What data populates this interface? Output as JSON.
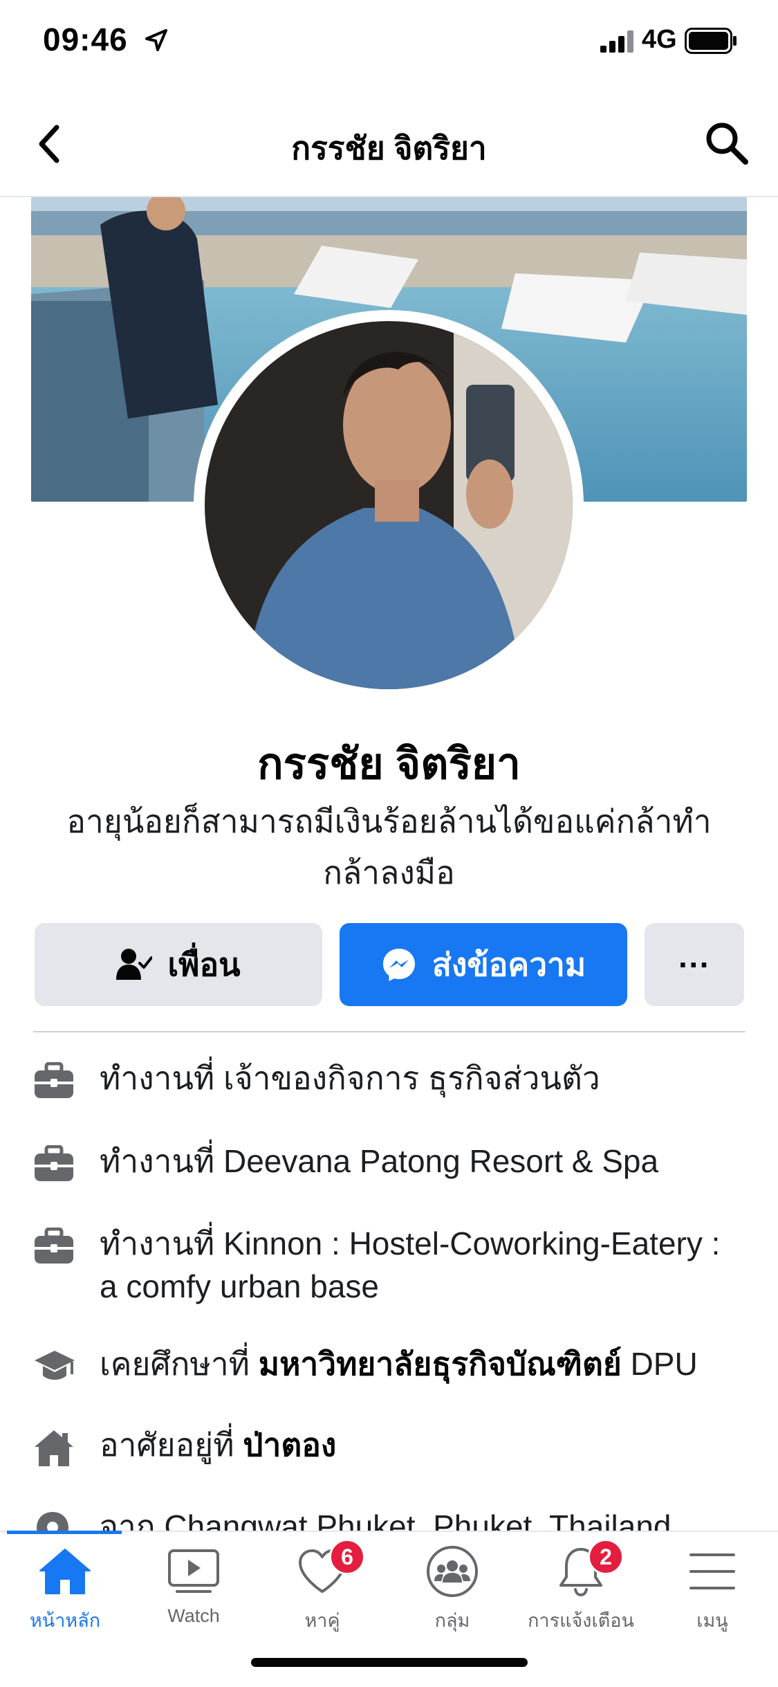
{
  "status_bar": {
    "time": "09:46",
    "network": "4G"
  },
  "header": {
    "title": "กรรชัย จิตริยา"
  },
  "profile": {
    "name": "กรรชัย จิตริยา",
    "bio_line1": "อายุน้อยก็สามารถมีเงินร้อยล้านได้ขอแค่กล้าทำ",
    "bio_line2": "กล้าลงมือ"
  },
  "actions": {
    "friends_label": "เพื่อน",
    "message_label": "ส่งข้อความ",
    "more_label": "···"
  },
  "details": [
    {
      "icon": "briefcase-icon",
      "prefix": "ทำงานที่",
      "text": "เจ้าของกิจการ ธุรกิจส่วนตัว"
    },
    {
      "icon": "briefcase-icon",
      "prefix": "ทำงานที่",
      "text": "Deevana Patong Resort & Spa"
    },
    {
      "icon": "briefcase-icon",
      "prefix": "ทำงานที่",
      "text": "Kinnon : Hostel-Coworking-Eatery :  a comfy urban base"
    },
    {
      "icon": "graduation-cap-icon",
      "prefix": "เคยศึกษาที่",
      "text": "มหาวิทยาลัยธุรกิจบัณฑิตย์",
      "suffix": "DPU"
    },
    {
      "icon": "house-icon",
      "prefix": "อาศัยอยู่ที่",
      "text": "ป่าตอง"
    },
    {
      "icon": "location-pin-icon",
      "prefix": "จาก",
      "text": "Changwat Phuket, Phuket, Thailand"
    }
  ],
  "tabs": [
    {
      "label": "หน้าหลัก",
      "icon": "home-icon",
      "active": true
    },
    {
      "label": "Watch",
      "icon": "watch-video-icon"
    },
    {
      "label": "หาคู่",
      "icon": "heart-icon",
      "badge": "6"
    },
    {
      "label": "กลุ่ม",
      "icon": "groups-icon"
    },
    {
      "label": "การแจ้งเตือน",
      "icon": "bell-icon",
      "badge": "2"
    },
    {
      "label": "เมนู",
      "icon": "hamburger-menu-icon"
    }
  ],
  "colors": {
    "accent": "#1877f2",
    "badge": "#e41e3f",
    "secondary_button": "#e4e6eb",
    "icon_gray": "#65676b"
  }
}
